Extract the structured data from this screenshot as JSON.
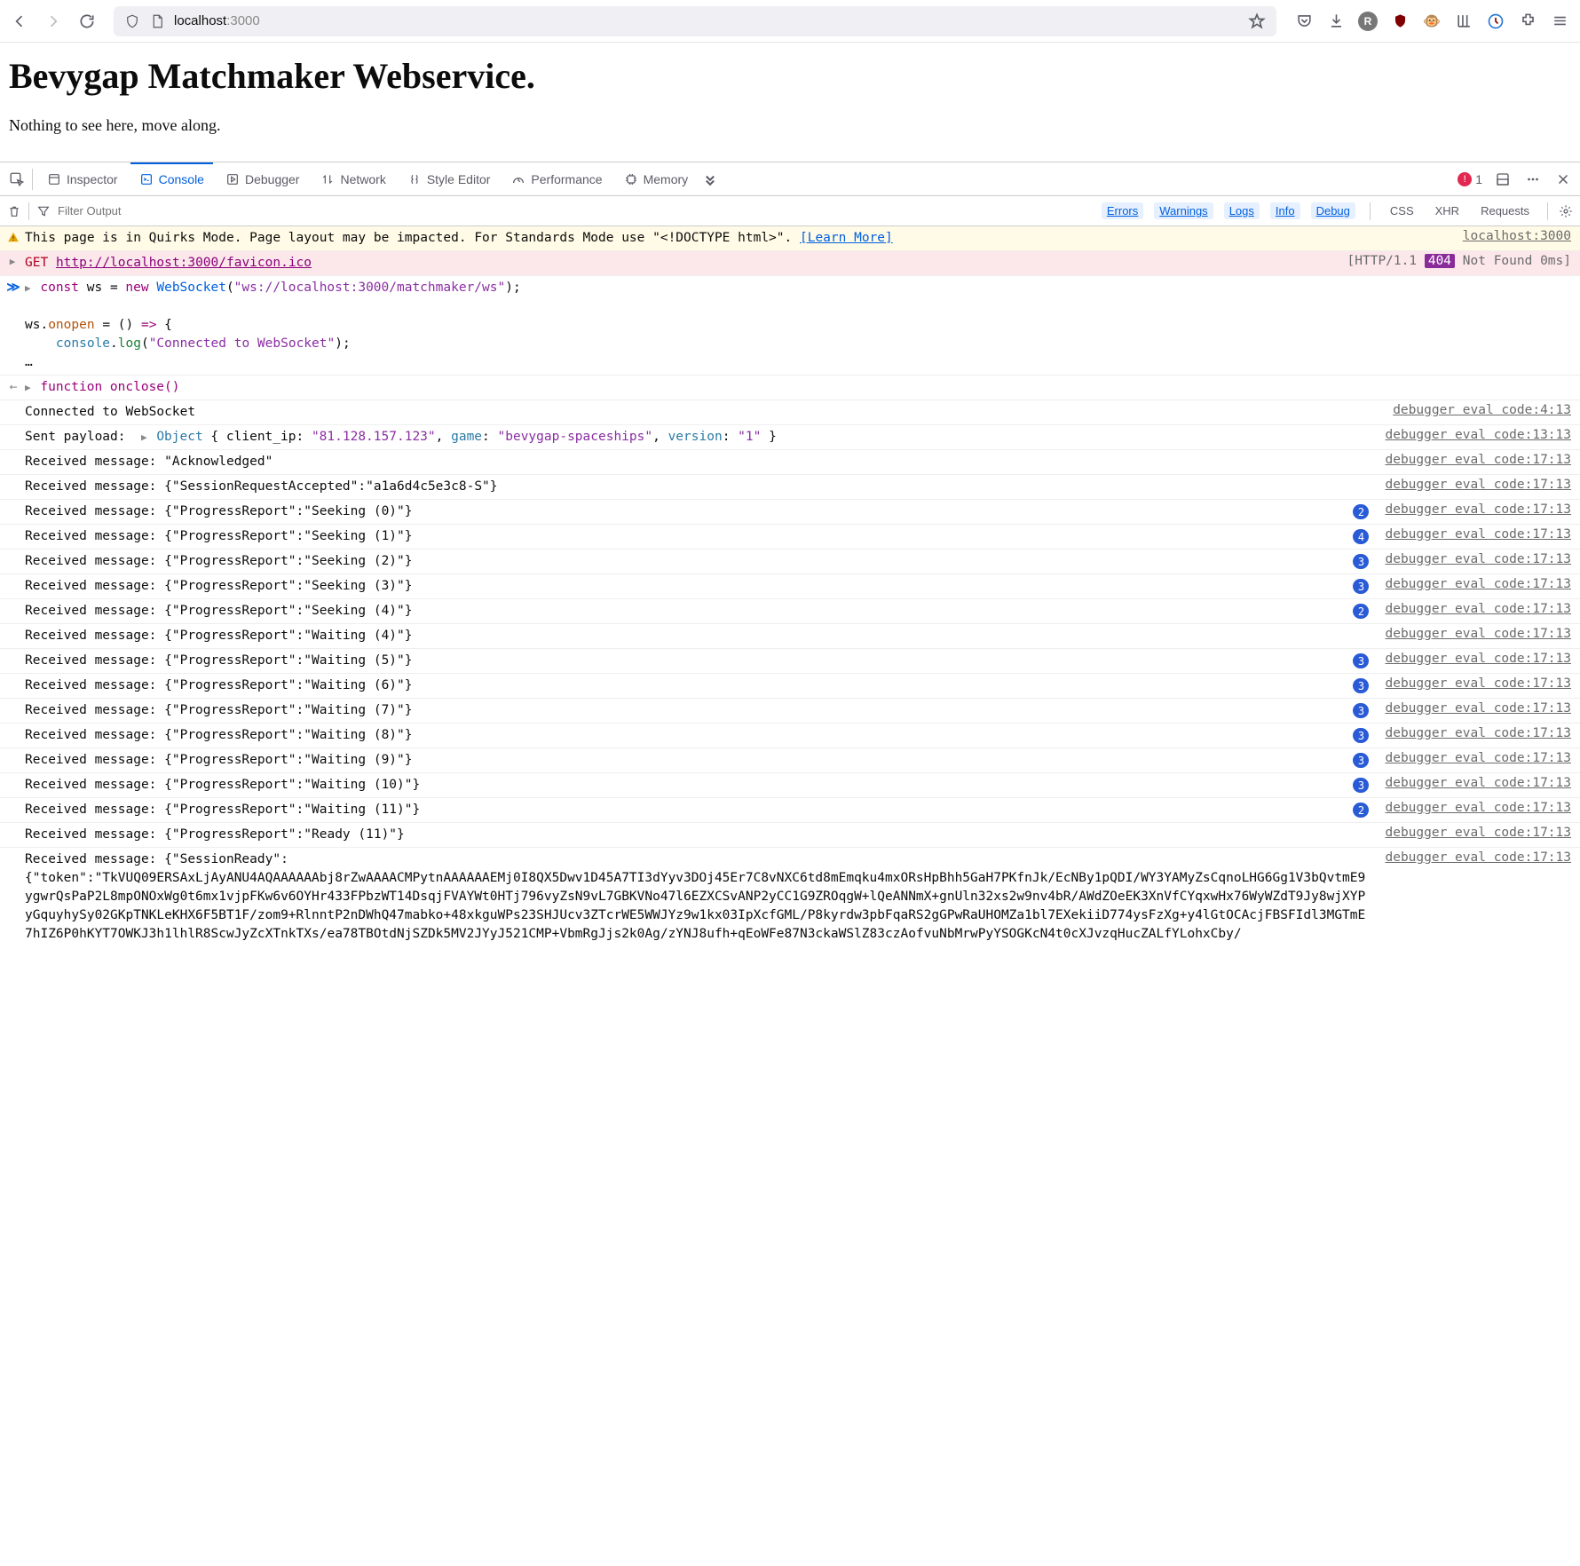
{
  "browser": {
    "url_host": "localhost",
    "url_port": ":3000",
    "star_tooltip": "Bookmark",
    "extensions": [
      "pocket",
      "download",
      "r-badge",
      "ublock",
      "tampermonkey",
      "grid",
      "dev-a11y",
      "ext",
      "menu"
    ]
  },
  "page": {
    "title": "Bevygap Matchmaker Webservice.",
    "body": "Nothing to see here, move along."
  },
  "devtools": {
    "tabs": [
      "Inspector",
      "Console",
      "Debugger",
      "Network",
      "Style Editor",
      "Performance",
      "Memory"
    ],
    "active_tab": 1,
    "error_count": "1",
    "filter_placeholder": "Filter Output",
    "chips_on": [
      "Errors",
      "Warnings",
      "Logs",
      "Info",
      "Debug"
    ],
    "chips_off": [
      "CSS",
      "XHR",
      "Requests"
    ]
  },
  "console": {
    "quirks_prefix": "This page is in Quirks Mode. Page layout may be impacted. For Standards Mode use \"<!DOCTYPE html>\". ",
    "quirks_learn": "[Learn More]",
    "quirks_src": "localhost:3000",
    "get_label": "GET",
    "get_url": "http://localhost:3000/favicon.ico",
    "get_status_prefix": "[HTTP/1.1 ",
    "get_status_code": "404",
    "get_status_suffix": " Not Found 0ms]",
    "input_line1": "const ws = new WebSocket(\"ws://localhost:3000/matchmaker/ws\");",
    "input_line2": "ws.onopen = () => {",
    "input_line3": "    console.log(\"Connected to WebSocket\");",
    "input_line4": "…",
    "output_fn": "function onclose()",
    "connected": "Connected to WebSocket",
    "sent_prefix": "Sent payload: ",
    "sent_object_label": "Object",
    "sent_object": "{ client_ip: \"81.128.157.123\", game: \"bevygap-spaceships\", version: \"1\" }",
    "src_conn": "debugger eval code:4:13",
    "src_sent": "debugger eval code:13:13",
    "src_recv": "debugger eval code:17:13",
    "rows": [
      {
        "msg": "Received message: \"Acknowledged\"",
        "repeat": null
      },
      {
        "msg": "Received message: {\"SessionRequestAccepted\":\"a1a6d4c5e3c8-S\"}",
        "repeat": null
      },
      {
        "msg": "Received message: {\"ProgressReport\":\"Seeking (0)\"}",
        "repeat": "2"
      },
      {
        "msg": "Received message: {\"ProgressReport\":\"Seeking (1)\"}",
        "repeat": "4"
      },
      {
        "msg": "Received message: {\"ProgressReport\":\"Seeking (2)\"}",
        "repeat": "3"
      },
      {
        "msg": "Received message: {\"ProgressReport\":\"Seeking (3)\"}",
        "repeat": "3"
      },
      {
        "msg": "Received message: {\"ProgressReport\":\"Seeking (4)\"}",
        "repeat": "2"
      },
      {
        "msg": "Received message: {\"ProgressReport\":\"Waiting (4)\"}",
        "repeat": null
      },
      {
        "msg": "Received message: {\"ProgressReport\":\"Waiting (5)\"}",
        "repeat": "3"
      },
      {
        "msg": "Received message: {\"ProgressReport\":\"Waiting (6)\"}",
        "repeat": "3"
      },
      {
        "msg": "Received message: {\"ProgressReport\":\"Waiting (7)\"}",
        "repeat": "3"
      },
      {
        "msg": "Received message: {\"ProgressReport\":\"Waiting (8)\"}",
        "repeat": "3"
      },
      {
        "msg": "Received message: {\"ProgressReport\":\"Waiting (9)\"}",
        "repeat": "3"
      },
      {
        "msg": "Received message: {\"ProgressReport\":\"Waiting (10)\"}",
        "repeat": "3"
      },
      {
        "msg": "Received message: {\"ProgressReport\":\"Waiting (11)\"}",
        "repeat": "2"
      },
      {
        "msg": "Received message: {\"ProgressReport\":\"Ready (11)\"}",
        "repeat": null
      }
    ],
    "session_ready_prefix": "Received message: {\"SessionReady\":",
    "session_ready_token": "{\"token\":\"TkVUQ09ERSAxLjAyANU4AQAAAAAAbj8rZwAAAACMPytnAAAAAAEMj0I8QX5Dwv1D45A7TI3dYyv3DOj45Er7C8vNXC6td8mEmqku4mxORsHpBhh5GaH7PKfnJk/EcNBy1pQDI/WY3YAMyZsCqnoLHG6Gg1V3bQvtmE9ygwrQsPaP2L8mpONOxWg0t6mx1vjpFKw6v6OYHr433FPbzWT14DsqjFVAYWt0HTj796vyZsN9vL7GBKVNo47l6EZXCSvANP2yCC1G9ZROqgW+lQeANNmX+gnUln32xs2w9nv4bR/AWdZOeEK3XnVfCYqxwHx76WyWZdT9Jy8wjXYPyGquyhySy02GKpTNKLeKHX6F5BT1F/zom9+RlnntP2nDWhQ47mabko+48xkguWPs23SHJUcv3ZTcrWE5WWJYz9w1kx03IpXcfGML/P8kyrdw3pbFqaRS2gGPwRaUHOMZa1bl7EXekiiD774ysFzXg+y4lGtOCAcjFBSFIdl3MGTmE7hIZ6P0hKYT7OWKJ3h1lhlR8ScwJyZcXTnkTXs/ea78TBOtdNjSZDk5MV2JYyJ521CMP+VbmRgJjs2k0Ag/zYNJ8ufh+qEoWFe87N3ckaWSlZ83czAofvuNbMrwPyYSOGKcN4t0cXJvzqHucZALfYLohxCby/"
  }
}
